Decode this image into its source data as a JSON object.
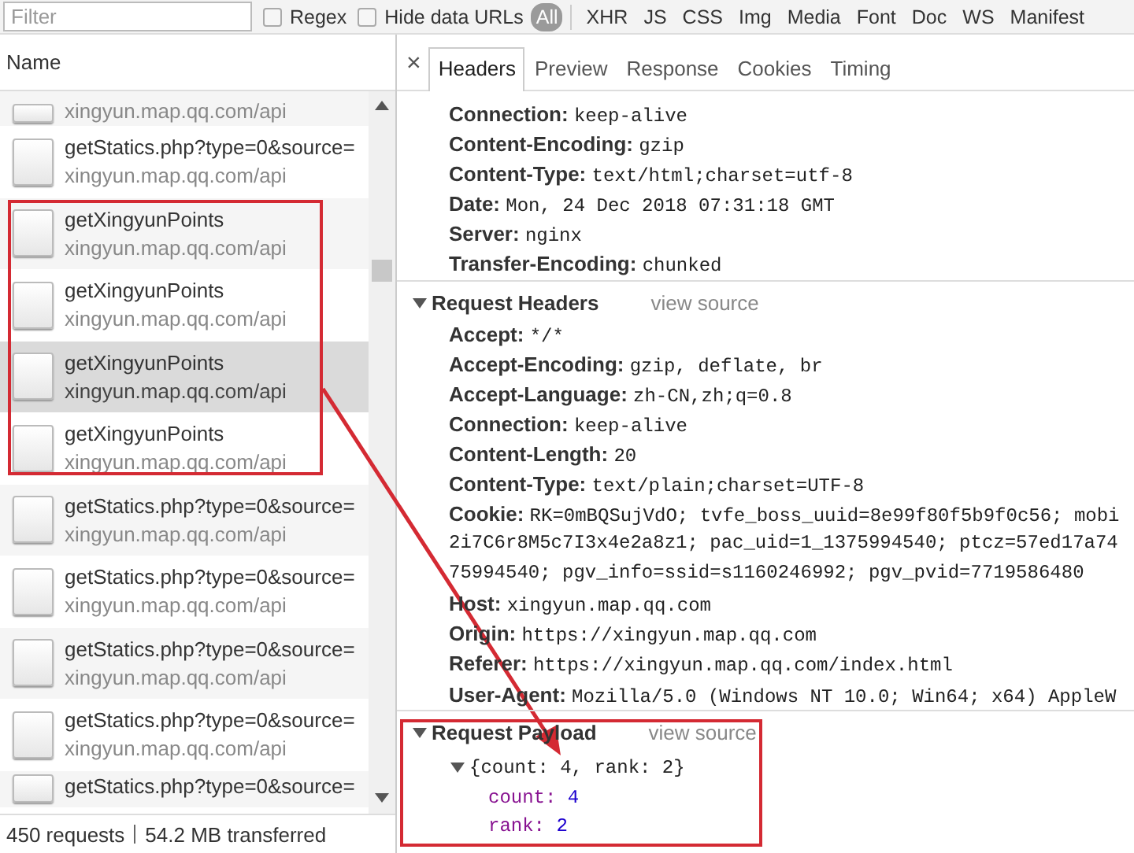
{
  "toolbar": {
    "filter": {
      "placeholder": "Filter"
    },
    "checkboxes": [
      {
        "label": "Regex",
        "checked": false
      },
      {
        "label": "Hide data URLs",
        "checked": false
      }
    ],
    "type_filters": [
      {
        "label": "All",
        "selected": true
      },
      {
        "label": "XHR",
        "selected": false
      },
      {
        "label": "JS",
        "selected": false
      },
      {
        "label": "CSS",
        "selected": false
      },
      {
        "label": "Img",
        "selected": false
      },
      {
        "label": "Media",
        "selected": false
      },
      {
        "label": "Font",
        "selected": false
      },
      {
        "label": "Doc",
        "selected": false
      },
      {
        "label": "WS",
        "selected": false
      },
      {
        "label": "Manifest",
        "selected": false
      }
    ]
  },
  "requests": {
    "column": "Name",
    "rows": [
      {
        "domain": "xingyun.map.qq.com/api",
        "selected": false
      },
      {
        "name": "getStatics.php?type=0&source=",
        "domain": "xingyun.map.qq.com/api",
        "selected": false
      },
      {
        "name": "getXingyunPoints",
        "domain": "xingyun.map.qq.com/api",
        "selected": false
      },
      {
        "name": "getXingyunPoints",
        "domain": "xingyun.map.qq.com/api",
        "selected": false
      },
      {
        "name": "getXingyunPoints",
        "domain": "xingyun.map.qq.com/api",
        "selected": true
      },
      {
        "name": "getXingyunPoints",
        "domain": "xingyun.map.qq.com/api",
        "selected": false
      },
      {
        "name": "getStatics.php?type=0&source=",
        "domain": "xingyun.map.qq.com/api",
        "selected": false
      },
      {
        "name": "getStatics.php?type=0&source=",
        "domain": "xingyun.map.qq.com/api",
        "selected": false
      },
      {
        "name": "getStatics.php?type=0&source=",
        "domain": "xingyun.map.qq.com/api",
        "selected": false
      },
      {
        "name": "getStatics.php?type=0&source=",
        "domain": "xingyun.map.qq.com/api",
        "selected": false
      },
      {
        "name": "getStatics.php?type=0&source=",
        "selected": false
      }
    ]
  },
  "status_bar": {
    "requests": "450 requests",
    "transferred": "54.2 MB transferred"
  },
  "detail": {
    "close": "×",
    "tabs": [
      {
        "label": "Headers",
        "selected": true
      },
      {
        "label": "Preview",
        "selected": false
      },
      {
        "label": "Response",
        "selected": false
      },
      {
        "label": "Cookies",
        "selected": false
      },
      {
        "label": "Timing",
        "selected": false
      }
    ],
    "sections": [
      {
        "kind": "headers",
        "headers": [
          {
            "name": "Connection:",
            "value": "keep-alive"
          },
          {
            "name": "Content-Encoding:",
            "value": "gzip"
          },
          {
            "name": "Content-Type:",
            "value": "text/html;charset=utf-8"
          },
          {
            "name": "Date:",
            "value": "Mon, 24 Dec 2018 07:31:18 GMT"
          },
          {
            "name": "Server:",
            "value": "nginx"
          },
          {
            "name": "Transfer-Encoding:",
            "value": "chunked"
          }
        ]
      },
      {
        "kind": "headers",
        "title": "Request Headers",
        "view_source": "view source",
        "expanded": true,
        "headers": [
          {
            "name": "Accept:",
            "value": "*/*"
          },
          {
            "name": "Accept-Encoding:",
            "value": "gzip, deflate, br"
          },
          {
            "name": "Accept-Language:",
            "value": "zh-CN,zh;q=0.8"
          },
          {
            "name": "Connection:",
            "value": "keep-alive"
          },
          {
            "name": "Content-Length:",
            "value": "20"
          },
          {
            "name": "Content-Type:",
            "value": "text/plain;charset=UTF-8"
          },
          {
            "name": "Cookie:",
            "value": "RK=0mBQSujVdO; tvfe_boss_uuid=8e99f80f5b9f0c56; mobi",
            "wrapped_lines": [
              "2i7C6r8M5c7I3x4e2a8z1; pac_uid=1_1375994540; ptcz=57ed17a74",
              "75994540; pgv_info=ssid=s1160246992; pgv_pvid=7719586480"
            ]
          },
          {
            "name": "Host:",
            "value": "xingyun.map.qq.com"
          },
          {
            "name": "Origin:",
            "value": "https://xingyun.map.qq.com"
          },
          {
            "name": "Referer:",
            "value": "https://xingyun.map.qq.com/index.html"
          },
          {
            "name": "User-Agent:",
            "value": "Mozilla/5.0 (Windows NT 10.0; Win64; x64) AppleW"
          }
        ]
      },
      {
        "kind": "payload",
        "title": "Request Payload",
        "view_source": "view source",
        "expanded": true,
        "object": {
          "summary": "{count: 4, rank: 2}",
          "expanded": true,
          "properties": [
            {
              "key": "count:",
              "value": "4"
            },
            {
              "key": "rank:",
              "value": "2"
            }
          ]
        }
      }
    ]
  }
}
